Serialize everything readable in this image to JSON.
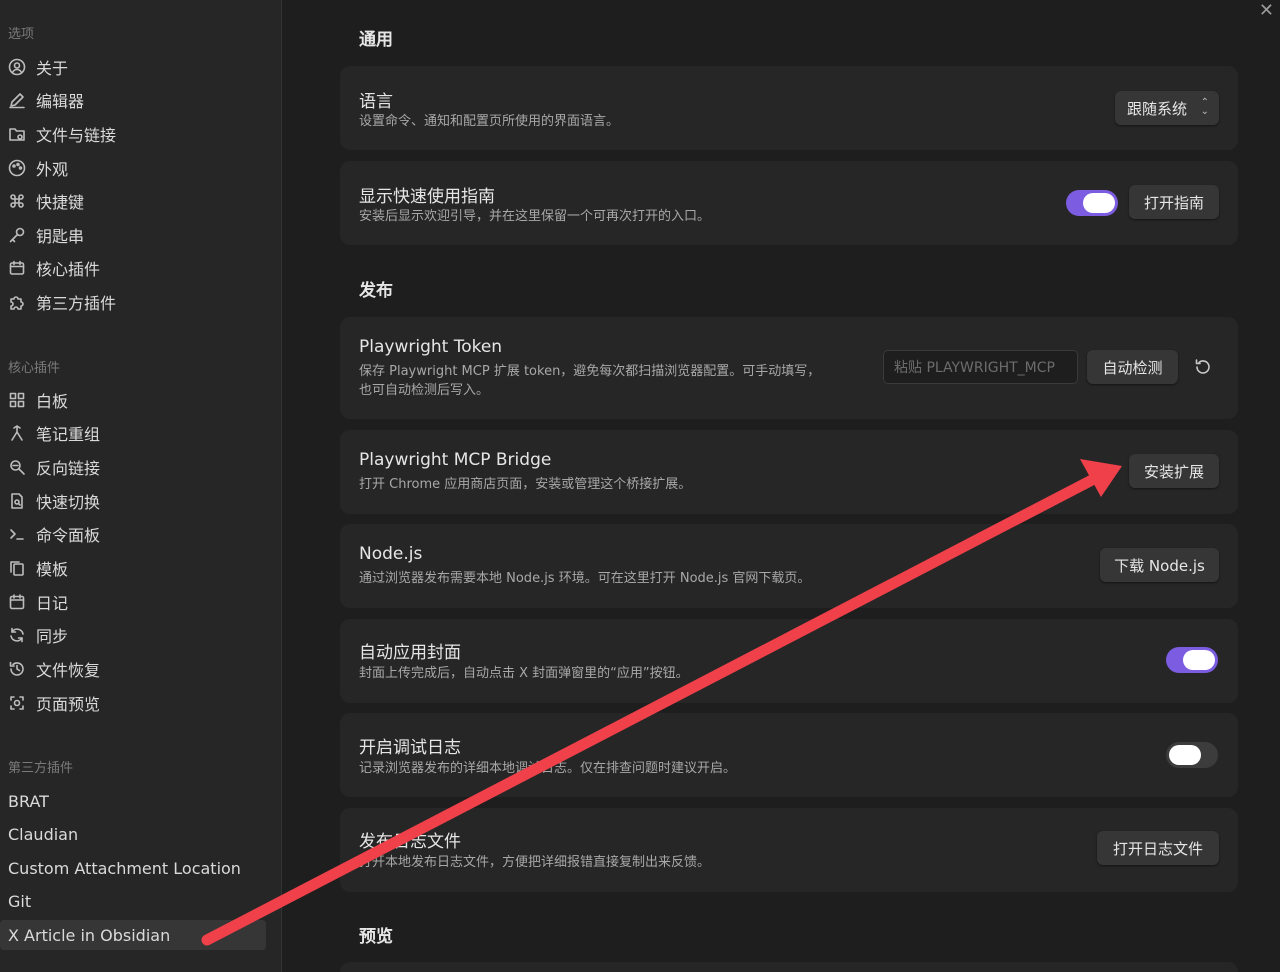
{
  "sidebar": {
    "heading_options": "选项",
    "options": [
      {
        "label": "关于",
        "icon": "user-circle-icon"
      },
      {
        "label": "编辑器",
        "icon": "pencil-icon"
      },
      {
        "label": "文件与链接",
        "icon": "folder-icon"
      },
      {
        "label": "外观",
        "icon": "palette-icon"
      },
      {
        "label": "快捷键",
        "icon": "command-icon"
      },
      {
        "label": "钥匙串",
        "icon": "key-icon"
      },
      {
        "label": "核心插件",
        "icon": "calendar-plugin-icon"
      },
      {
        "label": "第三方插件",
        "icon": "puzzle-icon"
      }
    ],
    "heading_core": "核心插件",
    "core": [
      {
        "label": "白板",
        "icon": "grid-icon"
      },
      {
        "label": "笔记重组",
        "icon": "merge-icon"
      },
      {
        "label": "反向链接",
        "icon": "search-link-icon"
      },
      {
        "label": "快速切换",
        "icon": "file-search-icon"
      },
      {
        "label": "命令面板",
        "icon": "terminal-icon"
      },
      {
        "label": "模板",
        "icon": "copy-icon"
      },
      {
        "label": "日记",
        "icon": "calendar-icon"
      },
      {
        "label": "同步",
        "icon": "refresh-icon"
      },
      {
        "label": "文件恢复",
        "icon": "history-icon"
      },
      {
        "label": "页面预览",
        "icon": "eye-icon"
      }
    ],
    "heading_third": "第三方插件",
    "third": [
      {
        "label": "BRAT"
      },
      {
        "label": "Claudian"
      },
      {
        "label": "Custom Attachment Location"
      },
      {
        "label": "Git"
      },
      {
        "label": "X Article in Obsidian"
      }
    ]
  },
  "main": {
    "close": "✕",
    "general_title": "通用",
    "language": {
      "name": "语言",
      "desc": "设置命令、通知和配置页所使用的界面语言。",
      "select_value": "跟随系统"
    },
    "guide": {
      "name": "显示快速使用指南",
      "desc": "安装后显示欢迎引导，并在这里保留一个可再次打开的入口。",
      "button": "打开指南",
      "toggle_on": true
    },
    "publish_title": "发布",
    "token": {
      "name": "Playwright Token",
      "desc1": "保存 Playwright MCP 扩展 token，避免每次都扫描浏览器配置。可手动填写，",
      "desc2": "也可自动检测后写入。",
      "placeholder": "粘贴 PLAYWRIGHT_MCP",
      "button": "自动检测"
    },
    "bridge": {
      "name": "Playwright MCP Bridge",
      "desc": "打开 Chrome 应用商店页面，安装或管理这个桥接扩展。",
      "button": "安装扩展"
    },
    "node": {
      "name": "Node.js",
      "desc": "通过浏览器发布需要本地 Node.js 环境。可在这里打开 Node.js 官网下载页。",
      "button": "下载 Node.js"
    },
    "cover": {
      "name": "自动应用封面",
      "desc": "封面上传完成后，自动点击 X 封面弹窗里的“应用”按钮。",
      "toggle_on": true
    },
    "debug": {
      "name": "开启调试日志",
      "desc": "记录浏览器发布的详细本地调试日志。仅在排查问题时建议开启。",
      "toggle_on": false
    },
    "logfile": {
      "name": "发布日志文件",
      "desc": "打开本地发布日志文件，方便把详细报错直接复制出来反馈。",
      "button": "打开日志文件"
    },
    "preview_title": "预览"
  },
  "colors": {
    "accent": "#7c5ce0",
    "arrow": "#f0404a"
  }
}
